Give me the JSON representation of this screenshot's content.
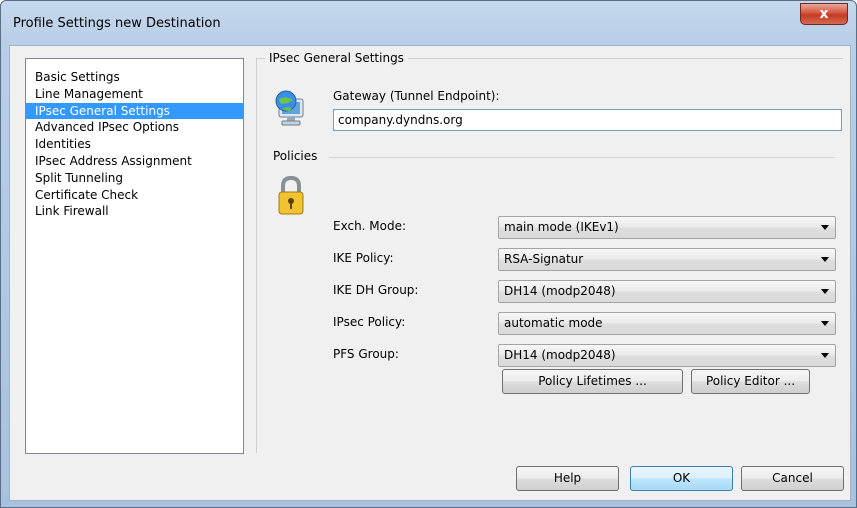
{
  "window": {
    "title": "Profile Settings   new Destination",
    "close_label": "x"
  },
  "nav": {
    "items": [
      {
        "label": "Basic Settings",
        "selected": false
      },
      {
        "label": "Line Management",
        "selected": false
      },
      {
        "label": "IPsec General Settings",
        "selected": true
      },
      {
        "label": "Advanced IPsec Options",
        "selected": false
      },
      {
        "label": "Identities",
        "selected": false
      },
      {
        "label": "IPsec Address Assignment",
        "selected": false
      },
      {
        "label": "Split Tunneling",
        "selected": false
      },
      {
        "label": "Certificate Check",
        "selected": false
      },
      {
        "label": "Link Firewall",
        "selected": false
      }
    ]
  },
  "panel": {
    "title": "IPsec General Settings",
    "gateway": {
      "label": "Gateway (Tunnel Endpoint):",
      "value": "company.dyndns.org"
    },
    "policies": {
      "title": "Policies",
      "rows": [
        {
          "label": "Exch. Mode:",
          "value": "main mode (IKEv1)"
        },
        {
          "label": "IKE Policy:",
          "value": "RSA-Signatur"
        },
        {
          "label": "IKE DH Group:",
          "value": "DH14 (modp2048)"
        },
        {
          "label": "IPsec Policy:",
          "value": "automatic mode"
        },
        {
          "label": "PFS Group:",
          "value": "DH14 (modp2048)"
        }
      ],
      "lifetimes_button": "Policy Lifetimes ...",
      "editor_button": "Policy Editor ..."
    }
  },
  "footer": {
    "help": "Help",
    "ok": "OK",
    "cancel": "Cancel"
  }
}
